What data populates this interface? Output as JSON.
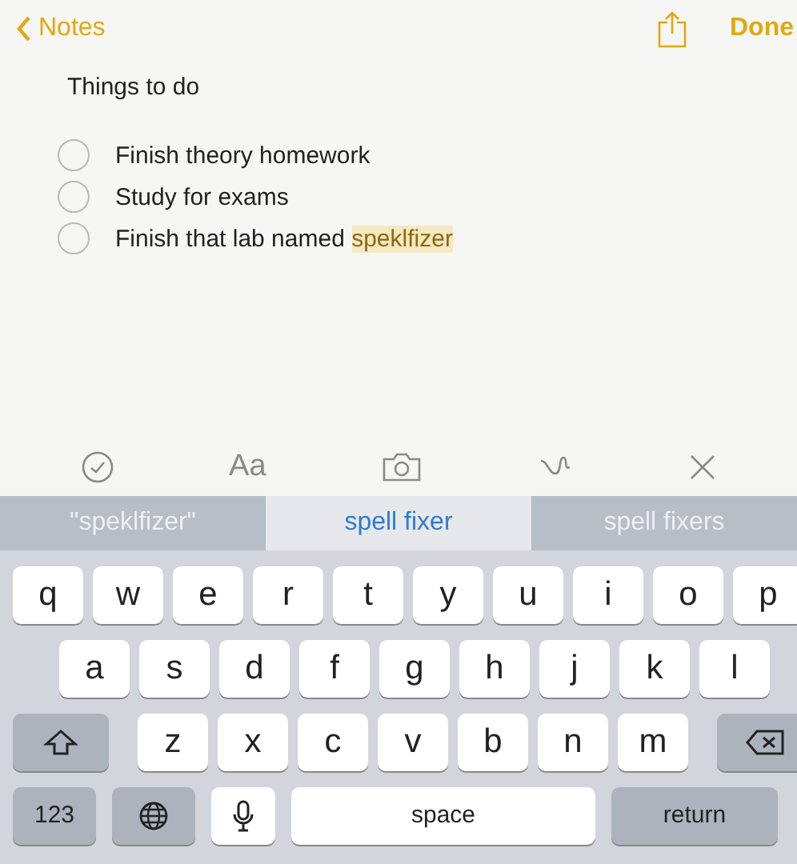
{
  "nav": {
    "back": "Notes",
    "done": "Done"
  },
  "note": {
    "title": "Things to do",
    "items": [
      {
        "text": "Finish theory homework",
        "checked": false
      },
      {
        "text": "Study for exams",
        "checked": false
      },
      {
        "text": "Finish that lab named ",
        "checked": false,
        "highlight": "speklfizer"
      }
    ]
  },
  "toolbar": [
    {
      "kind": "checklist"
    },
    {
      "kind": "format",
      "label": "Aa"
    },
    {
      "kind": "camera"
    },
    {
      "kind": "sketch"
    },
    {
      "kind": "close"
    }
  ],
  "suggestions": [
    {
      "text": "\"speklfizer\"",
      "selected": false
    },
    {
      "text": "spell fixer",
      "selected": true
    },
    {
      "text": "spell fixers",
      "selected": false
    }
  ],
  "keyboard": {
    "rows": [
      [
        "q",
        "w",
        "e",
        "r",
        "t",
        "y",
        "u",
        "i",
        "o",
        "p"
      ],
      [
        "a",
        "s",
        "d",
        "f",
        "g",
        "h",
        "j",
        "k",
        "l"
      ],
      [
        "z",
        "x",
        "c",
        "v",
        "b",
        "n",
        "m"
      ]
    ],
    "bottom": [
      {
        "kind": "numbers",
        "label": "123"
      },
      {
        "kind": "globe"
      },
      {
        "kind": "mic"
      },
      {
        "kind": "space",
        "label": "space"
      },
      {
        "kind": "return",
        "label": "return"
      }
    ]
  }
}
